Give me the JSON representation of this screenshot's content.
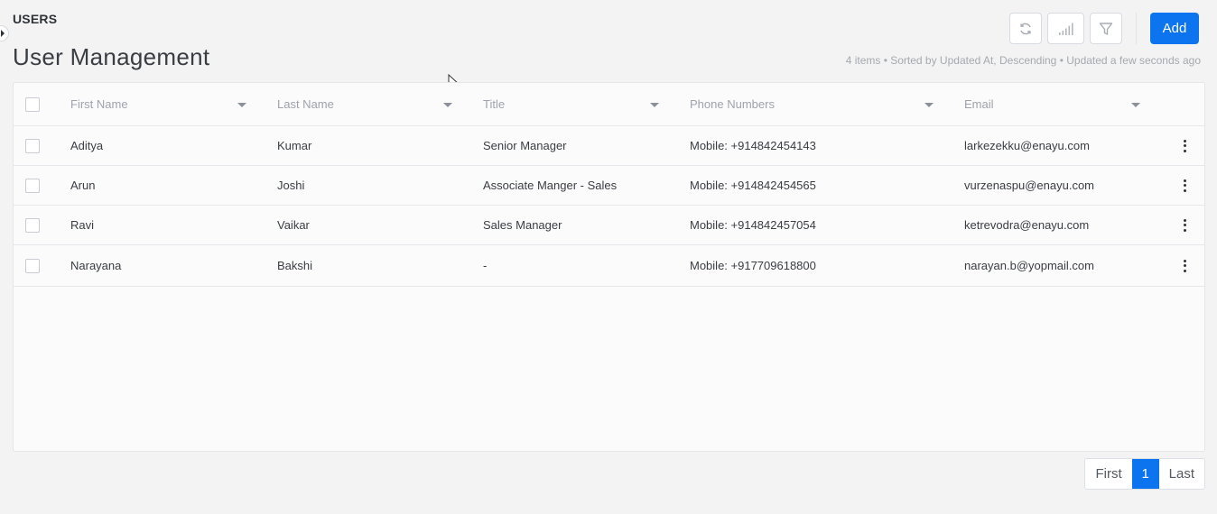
{
  "header": {
    "section_label": "USERS",
    "page_title": "User Management",
    "meta": "4 items • Sorted by Updated At, Descending • Updated a few seconds ago"
  },
  "toolbar": {
    "refresh_icon": "refresh-icon",
    "columns_icon": "bar-chart-icon",
    "filter_icon": "filter-icon",
    "add_label": "Add"
  },
  "table": {
    "columns": [
      "First Name",
      "Last Name",
      "Title",
      "Phone Numbers",
      "Email"
    ],
    "rows": [
      {
        "first": "Aditya",
        "last": "Kumar",
        "title": "Senior Manager",
        "phone": "Mobile: +914842454143",
        "email": "larkezekku@enayu.com"
      },
      {
        "first": "Arun",
        "last": "Joshi",
        "title": "Associate Manger - Sales",
        "phone": "Mobile: +914842454565",
        "email": "vurzenaspu@enayu.com"
      },
      {
        "first": "Ravi",
        "last": "Vaikar",
        "title": "Sales Manager",
        "phone": "Mobile: +914842457054",
        "email": "ketrevodra@enayu.com"
      },
      {
        "first": "Narayana",
        "last": "Bakshi",
        "title": "-",
        "phone": "Mobile: +917709618800",
        "email": "narayan.b@yopmail.com"
      }
    ]
  },
  "pagination": {
    "first": "First",
    "current": "1",
    "last": "Last"
  },
  "colors": {
    "accent": "#0d74f0",
    "background": "#f3f3f4"
  }
}
